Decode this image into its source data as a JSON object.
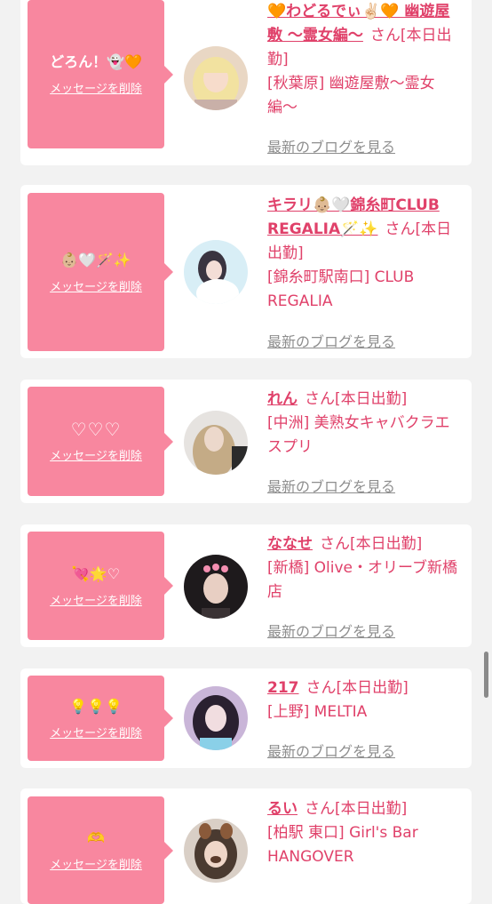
{
  "delete_label": "メッセージを削除",
  "blog_label": "最新のブログを見る",
  "san_suffix": "さん[本日出勤]",
  "colors": {
    "pink": "#f8879f",
    "accent": "#e0416a",
    "background": "#f2f2f2"
  },
  "cards": [
    {
      "message": "どろん！👻🧡",
      "name": "🧡わどるでぃ✌🏻🧡 幽遊屋敷 〜霊女編〜",
      "shop": "[秋葉原] 幽遊屋敷〜霊女編〜"
    },
    {
      "message": "👶🏼🤍🪄✨",
      "name": "キラリ👶🏼🤍錦糸町CLUB REGALIA🪄✨",
      "shop": "[錦糸町駅南口] CLUB REGALIA"
    },
    {
      "message": "♡♡♡",
      "name": "れん",
      "shop": "[中洲] 美熟女キャバクラエスプリ"
    },
    {
      "message": "💘🌟♡",
      "name": "ななせ",
      "shop": "[新橋] Olive・オリーブ新橋店"
    },
    {
      "message": "💡💡💡",
      "name": "217",
      "shop": "[上野] MELTIA"
    },
    {
      "message": "🫶",
      "name": "るい",
      "shop": "[柏駅 東口] Girl's Bar HANGOVER"
    }
  ]
}
